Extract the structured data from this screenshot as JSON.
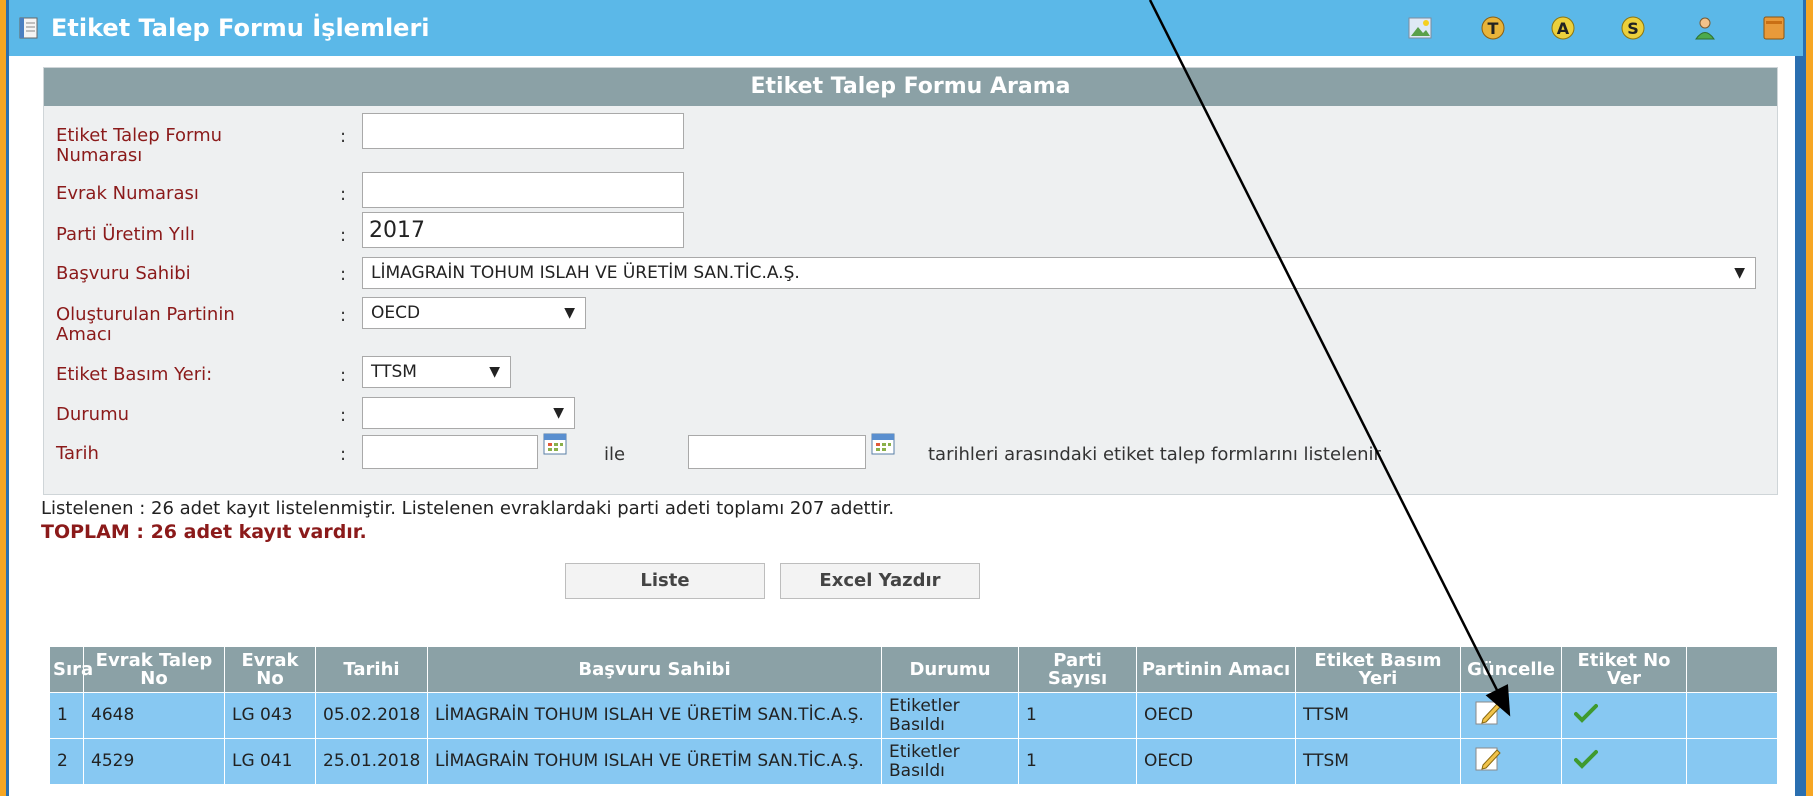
{
  "window": {
    "title": "Etiket Talep Formu İşlemleri"
  },
  "toolbar_icons": [
    "picture-icon",
    "letter-t-icon",
    "letter-a-icon",
    "letter-s-icon",
    "user-icon",
    "notepad-icon"
  ],
  "toolbar_letters": {
    "t": "T",
    "a": "A",
    "s": "S"
  },
  "search": {
    "header": "Etiket Talep Formu Arama",
    "form_no_label_line1": "Etiket Talep Formu",
    "form_no_label_line2": "Numarası",
    "form_no_value": "",
    "evrak_label": "Evrak Numarası",
    "evrak_value": "",
    "year_label": "Parti Üretim Yılı",
    "year_value": "2017",
    "applicant_label": "Başvuru Sahibi",
    "applicant_value": "LİMAGRAİN TOHUM ISLAH VE ÜRETİM SAN.TİC.A.Ş.",
    "purpose_label_line1": "Oluşturulan Partinin",
    "purpose_label_line2": "Amacı",
    "purpose_value": "OECD",
    "print_label": "Etiket Basım Yeri:",
    "print_value": "TTSM",
    "status_label": "Durumu",
    "status_value": "",
    "date_label": "Tarih",
    "date_from": "",
    "date_to": "",
    "date_between": "ile",
    "date_suffix": "tarihleri arasındaki etiket talep formlarını listelenir",
    "colon": ":",
    "dropdown_arrow": "▼"
  },
  "summary": {
    "listed": "Listelenen : 26 adet kayıt listelenmiştir. Listelenen evraklardaki parti adeti toplamı 207 adettir.",
    "total": "TOPLAM : 26 adet kayıt vardır."
  },
  "buttons": {
    "list": "Liste",
    "excel": "Excel Yazdır"
  },
  "table": {
    "headers": [
      "Sıra",
      "Evrak Talep No",
      "Evrak No",
      "Tarihi",
      "Başvuru Sahibi",
      "Durumu",
      "Parti Sayısı",
      "Partinin Amacı",
      "Etiket Basım Yeri",
      "Güncelle",
      "Etiket No Ver",
      ""
    ],
    "rows": [
      {
        "sira": "1",
        "talep_no": "4648",
        "evrak_no": "LG 043",
        "tarih": "05.02.2018",
        "sahip": "LİMAGRAİN TOHUM ISLAH VE ÜRETİM SAN.TİC.A.Ş.",
        "durum": "Etiketler Basıldı",
        "parti": "1",
        "amac": "OECD",
        "basim": "TTSM"
      },
      {
        "sira": "2",
        "talep_no": "4529",
        "evrak_no": "LG 041",
        "tarih": "25.01.2018",
        "sahip": "LİMAGRAİN TOHUM ISLAH VE ÜRETİM SAN.TİC.A.Ş.",
        "durum": "Etiketler Basıldı",
        "parti": "1",
        "amac": "OECD",
        "basim": "TTSM"
      }
    ]
  },
  "colors": {
    "titlebar": "#5bb8e8",
    "header": "#8ba1a6",
    "row": "#87c8f2",
    "label": "#8b1a1a",
    "frame": "#f6a623"
  }
}
